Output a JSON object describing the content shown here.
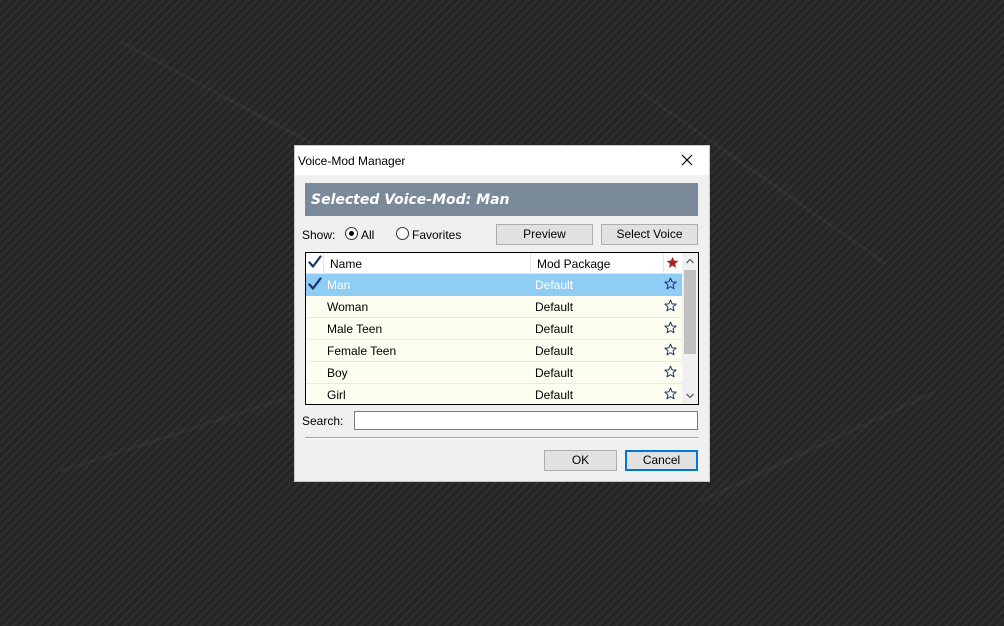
{
  "window": {
    "title": "Voice-Mod Manager"
  },
  "banner": {
    "text": "Selected Voice-Mod: Man"
  },
  "filter": {
    "show_label": "Show:",
    "options": [
      {
        "label": "All",
        "selected": true
      },
      {
        "label": "Favorites",
        "selected": false
      }
    ]
  },
  "actions": {
    "preview_label": "Preview",
    "select_voice_label": "Select Voice"
  },
  "table": {
    "columns": {
      "name": "Name",
      "package": "Mod Package"
    },
    "rows": [
      {
        "name": "Man",
        "package": "Default",
        "checked": true,
        "selected": true,
        "favorite": false
      },
      {
        "name": "Woman",
        "package": "Default",
        "checked": false,
        "selected": false,
        "favorite": false
      },
      {
        "name": "Male Teen",
        "package": "Default",
        "checked": false,
        "selected": false,
        "favorite": false
      },
      {
        "name": "Female Teen",
        "package": "Default",
        "checked": false,
        "selected": false,
        "favorite": false
      },
      {
        "name": "Boy",
        "package": "Default",
        "checked": false,
        "selected": false,
        "favorite": false
      },
      {
        "name": "Girl",
        "package": "Default",
        "checked": false,
        "selected": false,
        "favorite": false
      }
    ]
  },
  "search": {
    "label": "Search:",
    "value": ""
  },
  "footer": {
    "ok_label": "OK",
    "cancel_label": "Cancel"
  },
  "colors": {
    "banner_bg": "#7b8a9b",
    "selected_row": "#8fcdf5",
    "row_bg": "#fdfdf0",
    "check_color": "#1f2f6e",
    "favorite_header_star": "#b02020",
    "primary_border": "#0078d7"
  }
}
